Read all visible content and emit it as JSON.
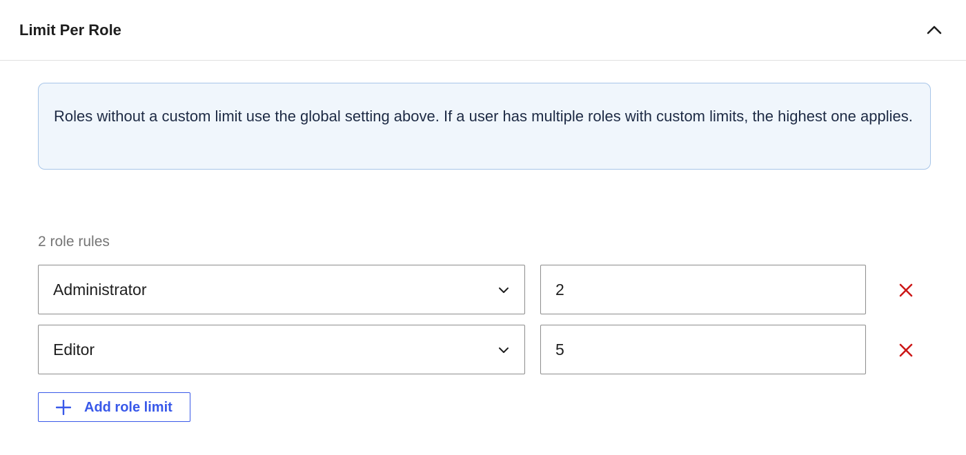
{
  "panel": {
    "title": "Limit Per Role",
    "toggle_icon": "chevron-up-icon"
  },
  "notice": {
    "text": "Roles without a custom limit use the global setting above. If a user has multiple roles with custom limits, the highest one applies."
  },
  "rules": {
    "count_label": "2 role rules",
    "items": [
      {
        "role": "Administrator",
        "limit": "2"
      },
      {
        "role": "Editor",
        "limit": "5"
      }
    ]
  },
  "add_button": {
    "label": "Add role limit",
    "icon": "plus-icon"
  },
  "colors": {
    "accent": "#3858e9",
    "danger": "#cc1818",
    "notice_bg": "#f0f6fc",
    "notice_border": "#a7c5e8"
  }
}
